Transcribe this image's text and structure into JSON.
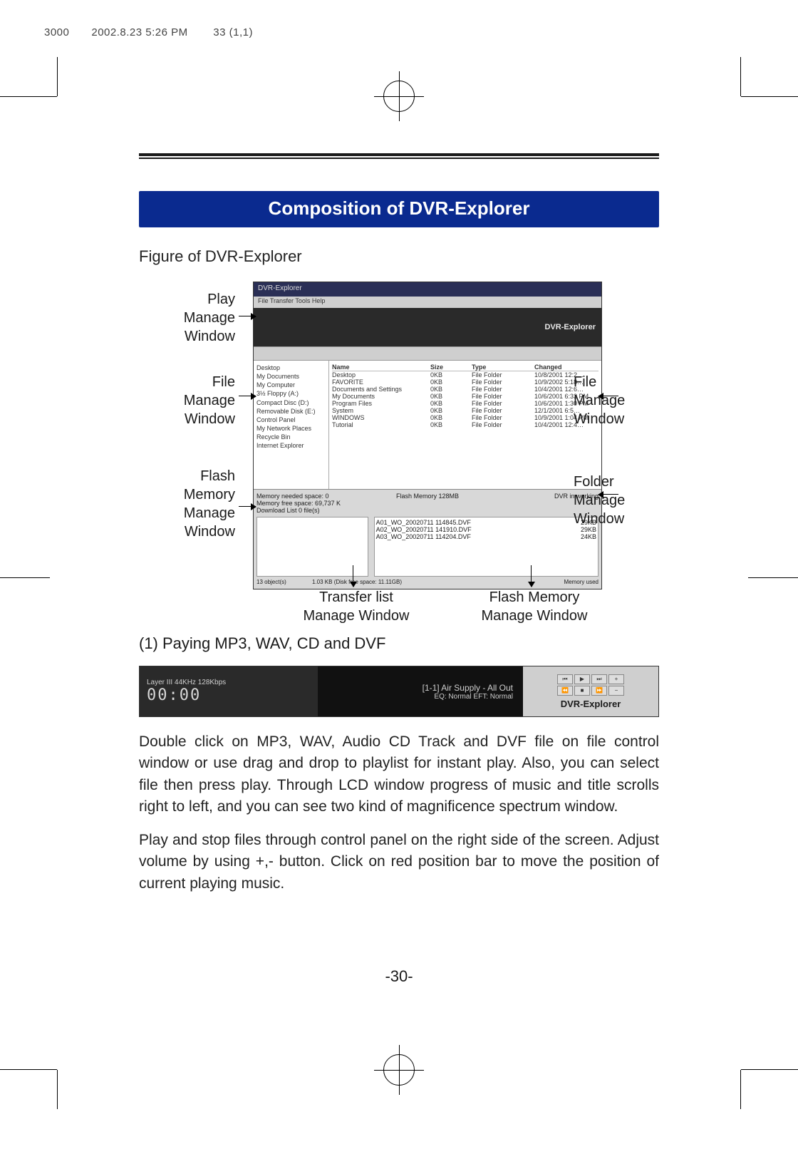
{
  "print_header": "3000　　2002.8.23 5:26 PM 　　33 (1,1)",
  "section_title": "Composition of DVR-Explorer",
  "figure_caption": "Figure of DVR-Explorer",
  "app_screenshot": {
    "titlebar": "DVR-Explorer",
    "menubar": "File  Transfer  Tools  Help",
    "player_brand": "DVR-Explorer",
    "tree_items": [
      "Desktop",
      "My Documents",
      "My Computer",
      "3½ Floppy (A:)",
      "Compact Disc (D:)",
      "Removable Disk (E:)",
      "Control Panel",
      "My Network Places",
      "Recycle Bin",
      "Internet Explorer"
    ],
    "file_columns": [
      "Name",
      "Size",
      "Type",
      "Changed"
    ],
    "file_rows": [
      {
        "name": "Desktop",
        "type": "File Folder",
        "changed": "10/8/2001 12:2…"
      },
      {
        "name": "FAVORITE",
        "type": "File Folder",
        "changed": "10/9/2002 5:18…"
      },
      {
        "name": "Documents and Settings",
        "type": "File Folder",
        "changed": "10/4/2001 12:6…"
      },
      {
        "name": "My Documents",
        "type": "File Folder",
        "changed": "10/6/2001 6:33 PM"
      },
      {
        "name": "Program Files",
        "type": "File Folder",
        "changed": "10/6/2001 1:30 PM"
      },
      {
        "name": "System",
        "type": "File Folder",
        "changed": "12/1/2001 6:5…"
      },
      {
        "name": "WINDOWS",
        "type": "File Folder",
        "changed": "10/9/2001 1:04 PM"
      },
      {
        "name": "Tutorial",
        "type": "File Folder",
        "changed": "10/4/2001 12:4…"
      }
    ],
    "lower_left_header": "Memory needed space: 0\nMemory free space: 69,737 K",
    "lower_download": "Download List 0 file(s)",
    "lower_mid_header": "Flash Memory 128MB",
    "lower_right_header": "DVR in working",
    "lower_files": [
      {
        "name": "A01_WO_20020711 114845.DVF",
        "size": "29KB"
      },
      {
        "name": "A02_WO_20020711 141910.DVF",
        "size": "29KB"
      },
      {
        "name": "A03_WO_20020711 114204.DVF",
        "size": "24KB"
      }
    ],
    "status_left": "13 object(s)",
    "status_mid": "1.03 KB (Disk free space: 11.11GB)",
    "status_right": "Memory used"
  },
  "callouts": {
    "play": "Play\nManage\nWindow",
    "file_l": "File\nManage\nWindow",
    "flash": "Flash\nMemory\nManage\nWindow",
    "file_r": "File\nManage\nWindow",
    "folder": "Folder\nManage\nWindow",
    "transfer": "Transfer list\nManage Window",
    "flash_b": "Flash Memory\nManage Window"
  },
  "subsection_title": "(1) Paying MP3, WAV, CD and DVF",
  "player_strip": {
    "lcd_top": "Layer III   44KHz  128Kbps",
    "lcd_time": "00:00",
    "center_line1": "[1-1] Air Supply - All Out",
    "center_line2": "EQ: Normal  EFT: Normal",
    "buttons_row1": [
      "⏮",
      "▶",
      "⏭",
      "+"
    ],
    "buttons_row2": [
      "⏪",
      "■",
      "⏩",
      "−"
    ],
    "brand": "DVR-Explorer"
  },
  "paragraph1": "Double click on MP3, WAV, Audio CD Track and DVF file on file control window or use drag and drop to playlist for instant play. Also, you can select file then press play. Through LCD window progress of music and title scrolls right to left, and you can see two kind of magnificence spectrum window.",
  "paragraph2": "Play and stop files through control panel on the right side of the screen. Adjust volume by using +,- button. Click on red position bar to move the position of current playing music.",
  "page_number": "-30-"
}
